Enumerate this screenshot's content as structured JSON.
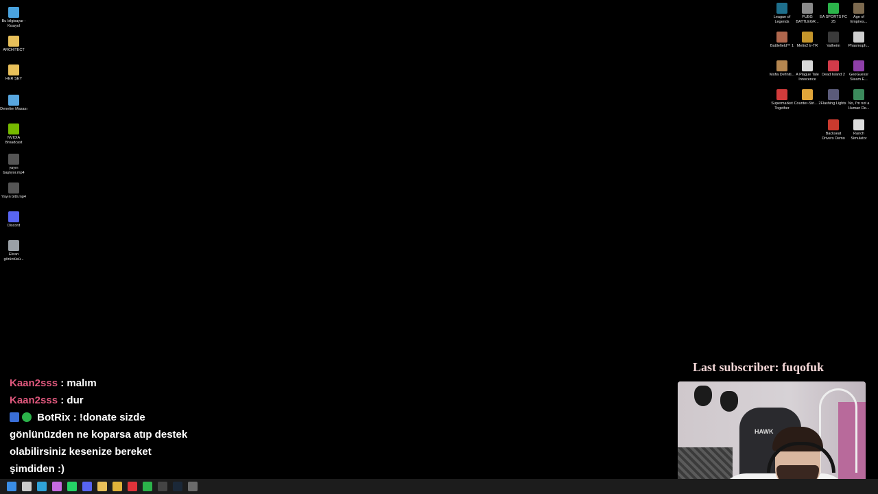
{
  "desktop_left": [
    {
      "label": "Bu bilgisayar - Kısayol",
      "icon": "computer-icon",
      "color": "#4aa3df"
    },
    {
      "label": "ARCHITECT",
      "icon": "folder-icon",
      "color": "#e8c05a"
    },
    {
      "label": "HER ŞEY",
      "icon": "folder-icon",
      "color": "#e8c05a"
    },
    {
      "label": "Denetim Masası",
      "icon": "control-panel-icon",
      "color": "#58a7e0"
    },
    {
      "label": "NVIDIA Broadcast",
      "icon": "nvidia-icon",
      "color": "#76b900"
    },
    {
      "label": "yayın başlıyor.mp4",
      "icon": "video-file-icon",
      "color": "#555555"
    },
    {
      "label": "Yayın bitti.mp4",
      "icon": "video-file-icon",
      "color": "#555555"
    },
    {
      "label": "Discord",
      "icon": "discord-icon",
      "color": "#5865f2"
    },
    {
      "label": "Ekran görüntüsü...",
      "icon": "image-file-icon",
      "color": "#9aa0a6"
    }
  ],
  "desktop_right": [
    {
      "label": "League of Legends",
      "icon": "lol-icon",
      "color": "#1e6f8c"
    },
    {
      "label": "PUBG BATTLEGR...",
      "icon": "pubg-icon",
      "color": "#8a8a8a"
    },
    {
      "label": "EA SPORTS FC 25",
      "icon": "fc25-icon",
      "color": "#2bb34a"
    },
    {
      "label": "Age of Empires...",
      "icon": "aoe-icon",
      "color": "#7d6a4f"
    },
    {
      "label": "Battlefield™ 1",
      "icon": "battlefield-icon",
      "color": "#b0674d"
    },
    {
      "label": "Metin2 tr-TR",
      "icon": "metin2-icon",
      "color": "#c4952b"
    },
    {
      "label": "Valheim",
      "icon": "valheim-icon",
      "color": "#3a3a3a"
    },
    {
      "label": "Phasmoph...",
      "icon": "phasmophobia-icon",
      "color": "#cfcfcf"
    },
    {
      "label": "Mafia Definiti...",
      "icon": "mafia-icon",
      "color": "#b58650"
    },
    {
      "label": "A Plague Tale Innocence",
      "icon": "plague-tale-icon",
      "color": "#d8d8d8"
    },
    {
      "label": "Dead Island 2",
      "icon": "dead-island-icon",
      "color": "#d23b4a"
    },
    {
      "label": "GeoGuessr Steam E...",
      "icon": "geoguessr-icon",
      "color": "#8e3fa8"
    },
    {
      "label": "Supermarket Together",
      "icon": "supermarket-icon",
      "color": "#d23b3b"
    },
    {
      "label": "Counter-Stri... 2",
      "icon": "cs2-icon",
      "color": "#e0a53a"
    },
    {
      "label": "Flashing Lights",
      "icon": "flashing-lights-icon",
      "color": "#5b5b7a"
    },
    {
      "label": "No, I'm not a Human De...",
      "icon": "not-human-icon",
      "color": "#3c8a5c"
    },
    {
      "label": "Backseat Drivers Demo",
      "icon": "backseat-icon",
      "color": "#c93a2e"
    },
    {
      "label": "Ranch Simulator",
      "icon": "ranch-icon",
      "color": "#dddddd"
    }
  ],
  "chat": {
    "messages": [
      {
        "user": "Kaan2sss",
        "text": "malım"
      },
      {
        "user": "Kaan2sss",
        "text": "dur"
      }
    ],
    "bot": {
      "user": "BotRix",
      "text": "!donate sizde gönlünüzden ne koparsa atıp destek olabilirsiniz kesenize bereket şimdiden :)"
    }
  },
  "overlay": {
    "last_subscriber": "Last subscriber: fuqofuk",
    "chair_brand": "HAWK"
  },
  "taskbar": [
    {
      "icon": "windows-start-icon",
      "color": "#3a8ee6"
    },
    {
      "icon": "search-icon",
      "color": "#cccccc"
    },
    {
      "icon": "edge-icon",
      "color": "#2fa3d8"
    },
    {
      "icon": "copilot-icon",
      "color": "#c66be0"
    },
    {
      "icon": "whatsapp-icon",
      "color": "#25d366"
    },
    {
      "icon": "discord-icon",
      "color": "#5865f2"
    },
    {
      "icon": "file-explorer-icon",
      "color": "#e8c05a"
    },
    {
      "icon": "chrome-icon",
      "color": "#e0b33a"
    },
    {
      "icon": "opera-icon",
      "color": "#e0333a"
    },
    {
      "icon": "xbox-icon",
      "color": "#2bb34a"
    },
    {
      "icon": "terminal-icon",
      "color": "#444444"
    },
    {
      "icon": "steam-icon",
      "color": "#1b2838"
    },
    {
      "icon": "obs-icon",
      "color": "#6b6b6b"
    }
  ]
}
